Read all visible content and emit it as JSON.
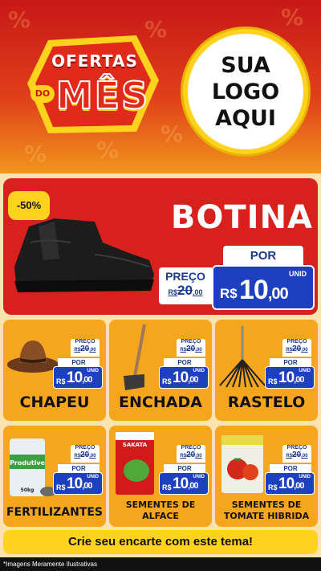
{
  "header": {
    "badge_top": "OFERTAS",
    "badge_do": "DO",
    "badge_main": "MÊS",
    "logo_lines": [
      "SUA",
      "LOGO",
      "AQUI"
    ]
  },
  "featured": {
    "discount": "-50%",
    "title": "BOTINA",
    "old_label": "PREÇO",
    "old_price_main": "20",
    "old_price_cents": ",00",
    "old_currency": "R$",
    "new_label": "POR",
    "unit": "UNID",
    "currency": "R$",
    "price_main": "10",
    "price_cents": ",00"
  },
  "products": [
    {
      "name": "CHAPEU",
      "old_label": "PREÇO",
      "old_main": "20",
      "old_cents": ",00",
      "old_currency": "R$",
      "por": "POR",
      "unit": "UNID",
      "currency": "R$",
      "main": "10",
      "cents": ",00"
    },
    {
      "name": "ENCHADA",
      "old_label": "PREÇO",
      "old_main": "20",
      "old_cents": ",00",
      "old_currency": "R$",
      "por": "POR",
      "unit": "UNID",
      "currency": "R$",
      "main": "10",
      "cents": ",00"
    },
    {
      "name": "RASTELO",
      "old_label": "PREÇO",
      "old_main": "20",
      "old_cents": ",00",
      "old_currency": "R$",
      "por": "POR",
      "unit": "UNID",
      "currency": "R$",
      "main": "10",
      "cents": ",00"
    },
    {
      "name": "FERTILIZANTES",
      "old_label": "PREÇO",
      "old_main": "20",
      "old_cents": ",00",
      "old_currency": "R$",
      "por": "POR",
      "unit": "UNID",
      "currency": "R$",
      "main": "10",
      "cents": ",00",
      "pack_brand": "Produtive",
      "pack_weight": "50kg"
    },
    {
      "name_line1": "SEMENTES DE",
      "name_line2": "ALFACE",
      "old_label": "PREÇO",
      "old_main": "20",
      "old_cents": ",00",
      "old_currency": "R$",
      "por": "POR",
      "unit": "UNID",
      "currency": "R$",
      "main": "10",
      "cents": ",00",
      "pack_brand": "SAKATA"
    },
    {
      "name_line1": "SEMENTES DE",
      "name_line2": "TOMATE HIBRIDA",
      "old_label": "PREÇO",
      "old_main": "20",
      "old_cents": ",00",
      "old_currency": "R$",
      "por": "POR",
      "unit": "UNID",
      "currency": "R$",
      "main": "10",
      "cents": ",00"
    }
  ],
  "cta": "Crie seu encarte com este tema!",
  "footer": "*Imagens Meramente Ilustrativas",
  "colors": {
    "red": "#d8211c",
    "orange": "#f6a61d",
    "yellow": "#ffd21e",
    "blue": "#1e3fc0"
  }
}
